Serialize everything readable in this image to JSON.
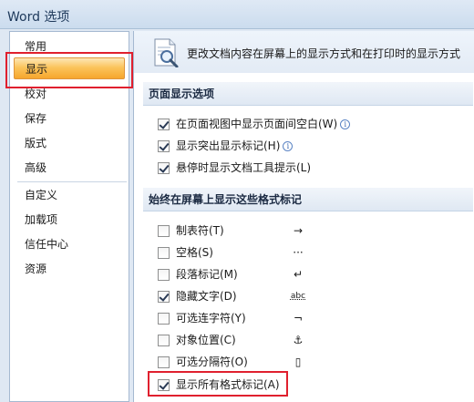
{
  "window": {
    "title": "Word 选项"
  },
  "sidebar": {
    "items": [
      {
        "label": "常用"
      },
      {
        "label": "显示"
      },
      {
        "label": "校对"
      },
      {
        "label": "保存"
      },
      {
        "label": "版式"
      },
      {
        "label": "高级"
      },
      {
        "label": "自定义"
      },
      {
        "label": "加载项"
      },
      {
        "label": "信任中心"
      },
      {
        "label": "资源"
      }
    ],
    "selected": "显示"
  },
  "header": {
    "text": "更改文档内容在屏幕上的显示方式和在打印时的显示方式"
  },
  "page_display": {
    "title": "页面显示选项",
    "options": [
      {
        "label": "在页面视图中显示页面间空白(W)",
        "checked": true,
        "info": "i"
      },
      {
        "label": "显示突出显示标记(H)",
        "checked": true,
        "info": "i"
      },
      {
        "label": "悬停时显示文档工具提示(L)",
        "checked": true
      }
    ]
  },
  "format_marks": {
    "title": "始终在屏幕上显示这些格式标记",
    "options": [
      {
        "label": "制表符(T)",
        "checked": false,
        "mark": "→",
        "icon": "tab-arrow-icon"
      },
      {
        "label": "空格(S)",
        "checked": false,
        "mark": "···",
        "icon": "space-dots-icon"
      },
      {
        "label": "段落标记(M)",
        "checked": false,
        "mark": "↵",
        "icon": "paragraph-mark-icon"
      },
      {
        "label": "隐藏文字(D)",
        "checked": true,
        "mark": "abc",
        "icon": "hidden-text-icon"
      },
      {
        "label": "可选连字符(Y)",
        "checked": false,
        "mark": "¬",
        "icon": "optional-hyphen-icon"
      },
      {
        "label": "对象位置(C)",
        "checked": false,
        "mark": "⚓",
        "icon": "anchor-icon"
      },
      {
        "label": "可选分隔符(O)",
        "checked": false,
        "mark": "▯",
        "icon": "optional-break-icon"
      },
      {
        "label": "显示所有格式标记(A)",
        "checked": true
      }
    ]
  },
  "colors": {
    "highlight": "#e0202e",
    "selected_nav": "#f6a62d"
  }
}
